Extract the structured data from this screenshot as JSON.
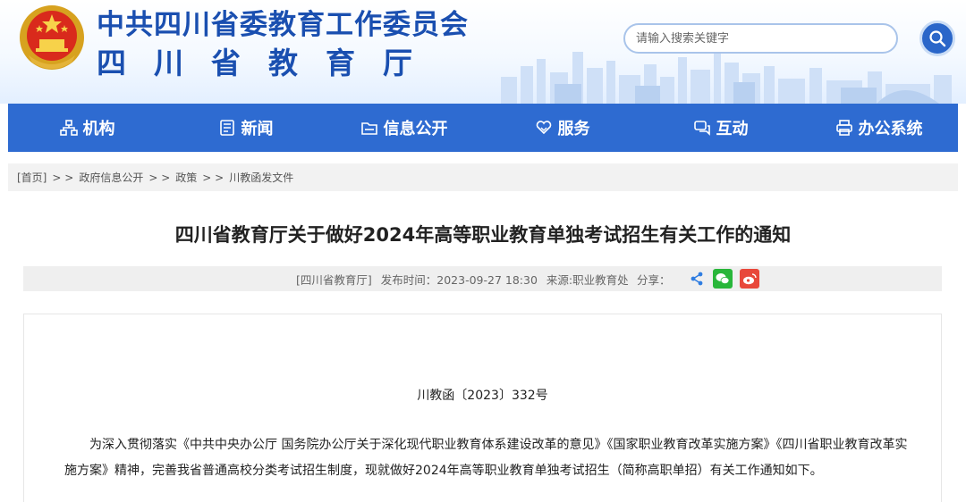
{
  "header": {
    "org_name": "中共四川省委教育工作委员会",
    "dept_name": "四川省教育厅",
    "emblem_icon": "national-emblem-icon",
    "search_placeholder": "请输入搜索关键字",
    "search_icon": "search-icon",
    "colors": {
      "title": "#1a4fb0",
      "nav": "#2e6bd1",
      "search_button": "#2a66c9"
    }
  },
  "nav": {
    "items": [
      {
        "label": "机构",
        "icon": "org-chart-icon"
      },
      {
        "label": "新闻",
        "icon": "newspaper-icon"
      },
      {
        "label": "信息公开",
        "icon": "folder-icon"
      },
      {
        "label": "服务",
        "icon": "heart-hand-icon"
      },
      {
        "label": "互动",
        "icon": "chat-icon"
      },
      {
        "label": "办公系统",
        "icon": "printer-icon"
      }
    ]
  },
  "breadcrumb": {
    "home": "[首页]",
    "sep": "> >",
    "items": [
      "政府信息公开",
      "政策",
      "川教函发文件"
    ]
  },
  "article": {
    "title": "四川省教育厅关于做好2024年高等职业教育单独考试招生有关工作的通知",
    "meta": {
      "publisher": "[四川省教育厅]",
      "time_label": "发布时间：",
      "time": "2023-09-27 18:30",
      "source": "来源:职业教育处",
      "share_label": "分享："
    },
    "share_icons": [
      "share-icon",
      "wechat-icon",
      "weibo-icon"
    ],
    "doc_no": "川教函〔2023〕332号",
    "paragraph": "为深入贯彻落实《中共中央办公厅 国务院办公厅关于深化现代职业教育体系建设改革的意见》《国家职业教育改革实施方案》《四川省职业教育改革实施方案》精神，完善我省普通高校分类考试招生制度，现就做好2024年高等职业教育单独考试招生（简称高职单招）有关工作通知如下。"
  }
}
